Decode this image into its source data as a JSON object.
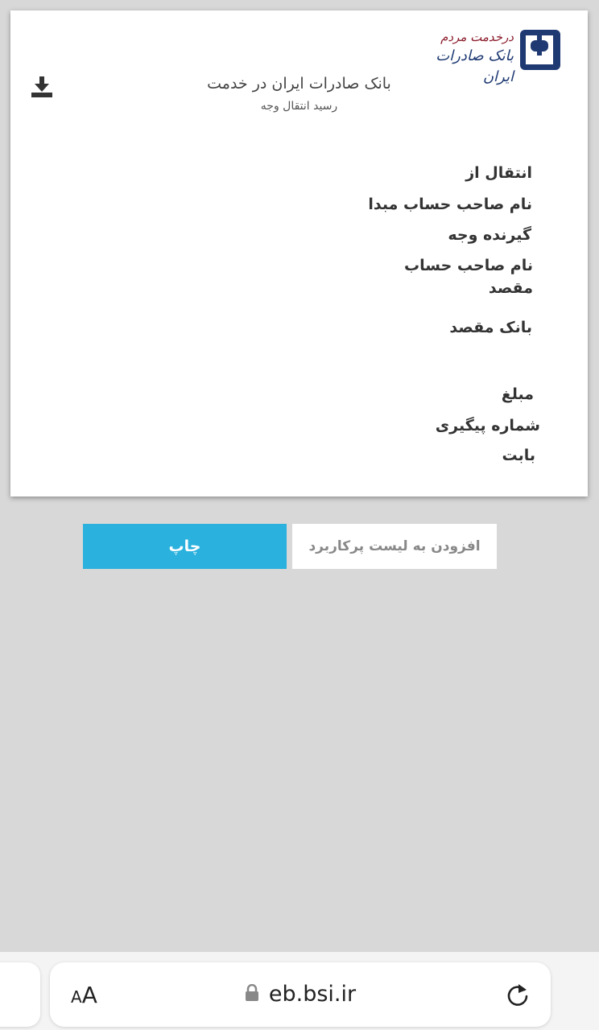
{
  "logo": {
    "slogan": "درخدمت مردم",
    "name": "بانک صادرات ایران"
  },
  "header": {
    "title": "بانک صادرات ایران  در  خدمت",
    "subtitle": "رسید  انتقال وجه"
  },
  "fields": {
    "transfer_from": "انتقال از",
    "source_owner": "نام صاحب حساب مبدا",
    "recipient": "گیرنده وجه",
    "dest_owner": "نام صاحب حساب مقصد",
    "dest_bank": "بانک  مقصد",
    "amount": "مبلغ",
    "tracking_number": "شماره  پیگیری",
    "purpose": "بابت"
  },
  "buttons": {
    "print": "چاپ",
    "add_to_list": "افزودن به لیست  پرکاربرد"
  },
  "browser": {
    "text_size_small": "A",
    "text_size_large": "A",
    "url": "eb.bsi.ir"
  },
  "icons": [
    "download-icon",
    "lock-icon",
    "reload-icon",
    "bank-logo-icon"
  ],
  "colors": {
    "accent": "#2ab1de",
    "logo_blue": "#1f3a73",
    "logo_red": "#8a1b2b",
    "background": "#d8d8d8"
  }
}
